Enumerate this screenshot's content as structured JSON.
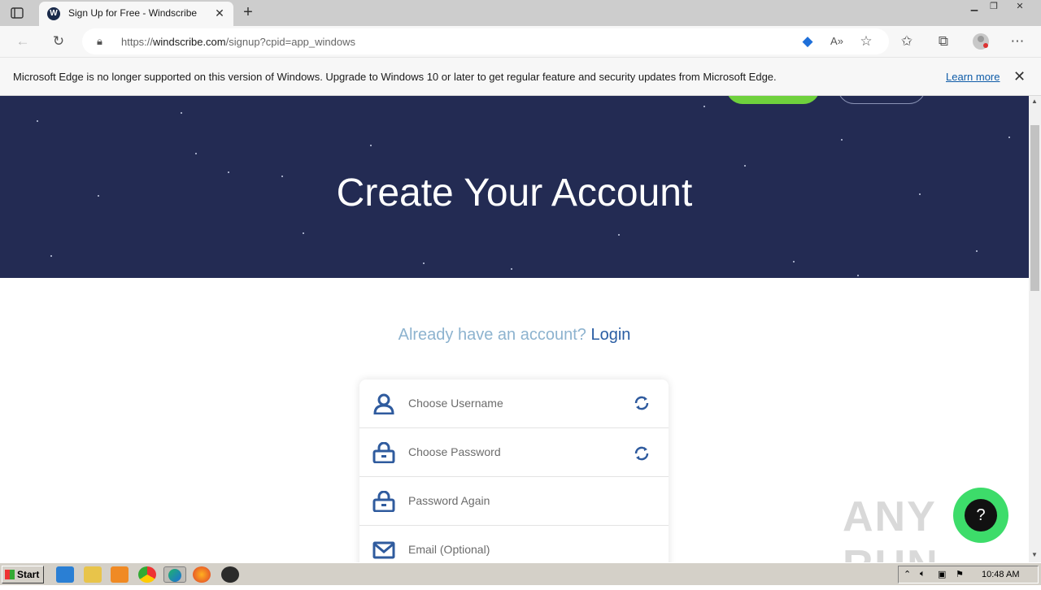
{
  "browser": {
    "tab_title": "Sign Up for Free - Windscribe",
    "url_prefix": "https://",
    "url_host": "windscribe.com",
    "url_path": "/signup?cpid=app_windows"
  },
  "infobar": {
    "message": "Microsoft Edge is no longer supported on this version of Windows. Upgrade to Windows 10 or later to get regular feature and security updates from Microsoft Edge.",
    "link": "Learn more"
  },
  "hero": {
    "title": "Create Your Account"
  },
  "login_prompt": {
    "text": "Already have an account?",
    "link": "Login"
  },
  "form": {
    "username_placeholder": "Choose Username",
    "password_placeholder": "Choose Password",
    "password_again_placeholder": "Password Again",
    "email_placeholder": "Email (Optional)"
  },
  "watermark": "ANY RUN",
  "taskbar": {
    "start_label": "Start",
    "clock": "10:48 AM"
  },
  "colors": {
    "hero_bg": "#232b53",
    "login_link": "#2a5da3",
    "form_icon": "#2f5b9e",
    "accent_green": "#6fd13d"
  }
}
